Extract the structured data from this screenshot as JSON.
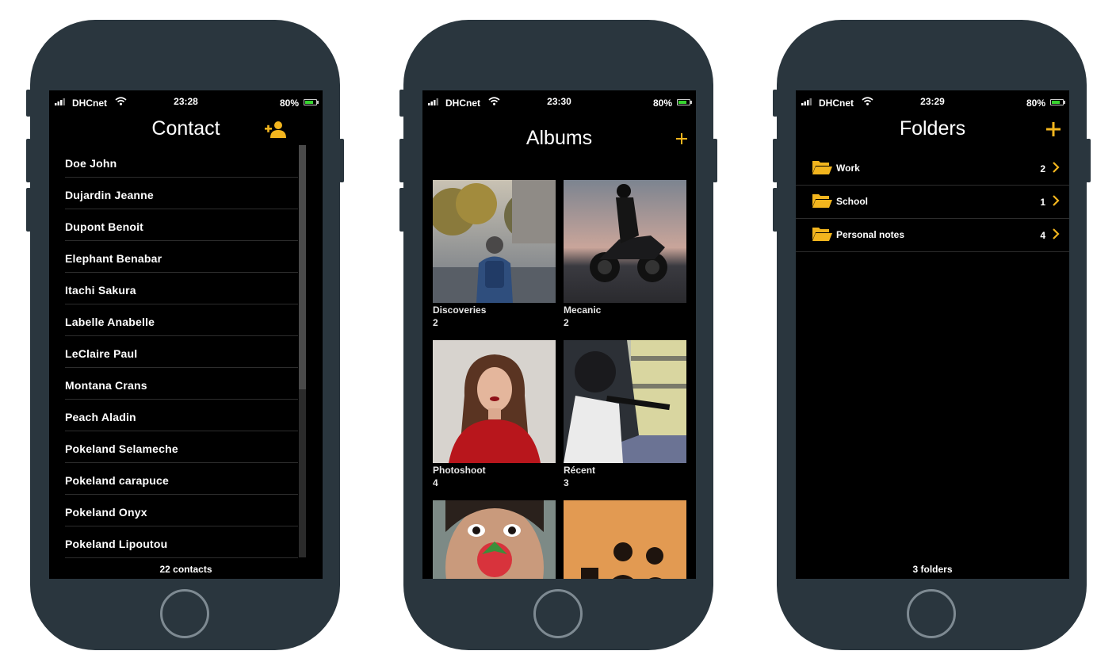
{
  "status": {
    "carrier": "DHCnet",
    "battery_pct": "80%",
    "battery_level": 0.8,
    "contact_time": "23:28",
    "albums_time": "23:30",
    "folders_time": "23:29"
  },
  "colors": {
    "accent": "#f2b51e",
    "device": "#2a363e",
    "battery": "#38d430"
  },
  "contacts": {
    "title": "Contact",
    "add_icon": "add-person-icon",
    "items": [
      {
        "name": "Doe John"
      },
      {
        "name": "Dujardin Jeanne"
      },
      {
        "name": "Dupont Benoit"
      },
      {
        "name": "Elephant Benabar"
      },
      {
        "name": "Itachi Sakura"
      },
      {
        "name": "Labelle Anabelle"
      },
      {
        "name": "LeClaire Paul"
      },
      {
        "name": "Montana Crans"
      },
      {
        "name": "Peach Aladin"
      },
      {
        "name": "Pokeland Selameche"
      },
      {
        "name": "Pokeland carapuce"
      },
      {
        "name": "Pokeland Onyx"
      },
      {
        "name": "Pokeland Lipoutou"
      }
    ],
    "footer": "22 contacts"
  },
  "albums": {
    "title": "Albums",
    "add_icon": "plus-icon",
    "items": [
      {
        "name": "Discoveries",
        "count": "2"
      },
      {
        "name": "Mecanic",
        "count": "2"
      },
      {
        "name": "Photoshoot",
        "count": "4"
      },
      {
        "name": "Récent",
        "count": "3"
      }
    ]
  },
  "folders": {
    "title": "Folders",
    "add_icon": "plus-icon",
    "items": [
      {
        "name": "Work",
        "count": "2"
      },
      {
        "name": "School",
        "count": "1"
      },
      {
        "name": "Personal notes",
        "count": "4"
      }
    ],
    "footer": "3 folders"
  }
}
